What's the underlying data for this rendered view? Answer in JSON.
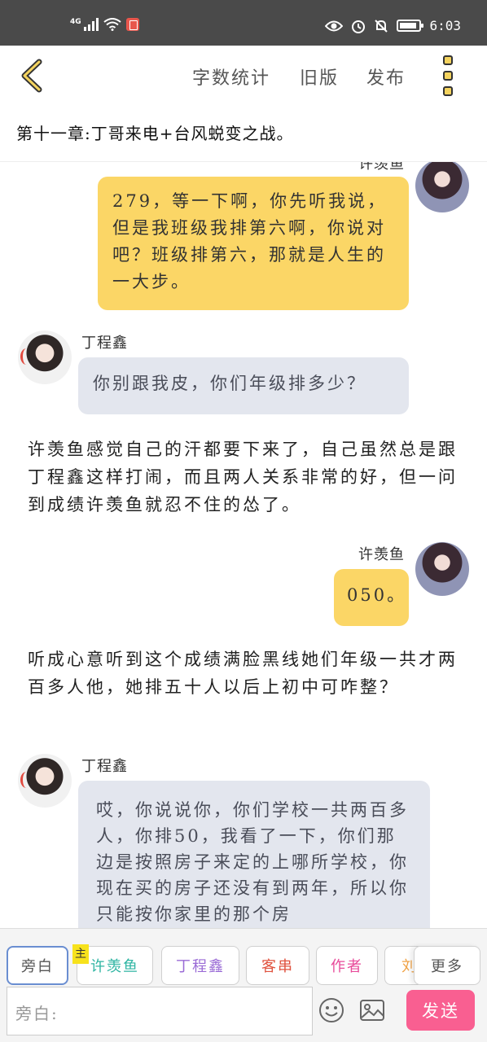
{
  "status_bar": {
    "network": "4G",
    "time": "6:03"
  },
  "toolbar": {
    "word_count_label": "字数统计",
    "old_version_label": "旧版",
    "publish_label": "发布"
  },
  "chapter_title": "第十一章:丁哥来电+台风蜕变之战。",
  "messages": [
    {
      "speaker": "许羡鱼",
      "text": "279，等一下啊，你先听我说，但是我班级我排第六啊，你说对吧？班级排第六，那就是人生的一大步。"
    },
    {
      "speaker": "丁程鑫",
      "text": "你别跟我皮，你们年级排多少？"
    },
    {
      "narration": "许羡鱼感觉自己的汗都要下来了，自己虽然总是跟丁程鑫这样打闹，而且两人关系非常的好，但一问到成绩许羡鱼就忍不住的怂了。"
    },
    {
      "speaker": "许羡鱼",
      "text": "050。"
    },
    {
      "narration": "听成心意听到这个成绩满脸黑线她们年级一共才两百多人他，她排五十人以后上初中可咋整？"
    },
    {
      "speaker": "丁程鑫",
      "text": "哎，你说说你，你们学校一共两百多人，你排50，我看了一下，你们那边是按照房子来定的上哪所学校，你现在买的房子还没有到两年，所以你只能按你家里的那个房"
    }
  ],
  "roles": {
    "main_mark": "主",
    "items": [
      {
        "label": "旁白",
        "color": "#555555"
      },
      {
        "label": "许羡鱼",
        "color": "#2fb5a3"
      },
      {
        "label": "丁程鑫",
        "color": "#9a6bd6"
      },
      {
        "label": "客串",
        "color": "#e0533f"
      },
      {
        "label": "作者",
        "color": "#e84a9a"
      },
      {
        "label": "刘",
        "color": "#f0a245"
      },
      {
        "label": "更多",
        "color": "#555555"
      }
    ]
  },
  "input": {
    "placeholder": "旁白:",
    "send_label": "发送"
  }
}
